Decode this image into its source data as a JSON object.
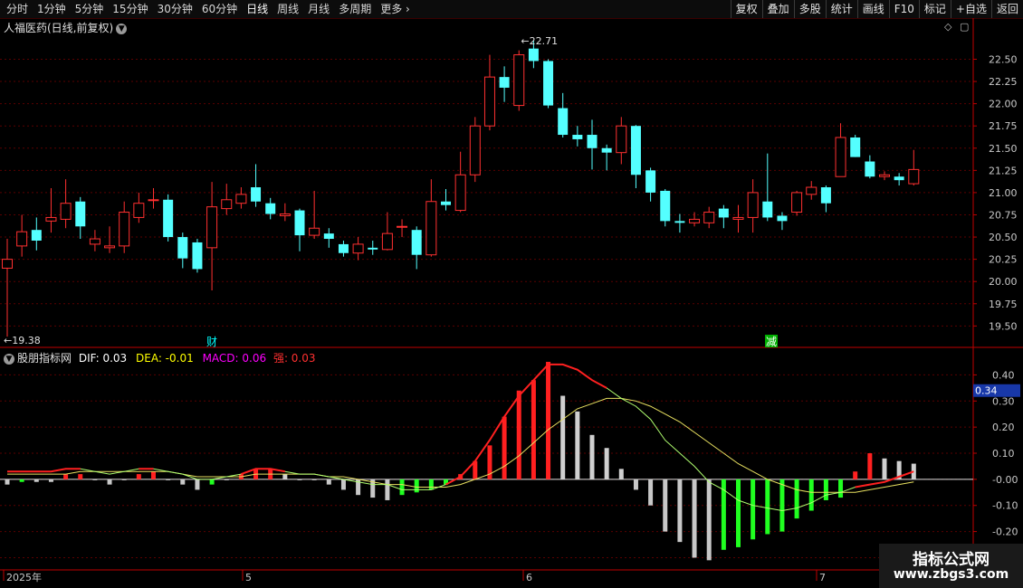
{
  "toolbar": {
    "periods": [
      "分时",
      "1分钟",
      "5分钟",
      "15分钟",
      "30分钟",
      "60分钟",
      "日线",
      "周线",
      "月线",
      "多周期",
      "更多"
    ],
    "active_period": "日线",
    "more_chevron": "chevron-right-icon",
    "right_buttons": [
      "复权",
      "叠加",
      "多股",
      "统计",
      "画线",
      "F10",
      "标记",
      "+自选",
      "返回"
    ]
  },
  "main_chart": {
    "title": "人福医药(日线,前复权)",
    "y_ticks": [
      "22.50",
      "22.25",
      "22.00",
      "21.75",
      "21.50",
      "21.25",
      "21.00",
      "20.75",
      "20.50",
      "20.25",
      "20.00",
      "19.75",
      "19.50"
    ],
    "high_marker": "22.71",
    "low_marker": "19.38",
    "event_labels": [
      "财",
      "减"
    ]
  },
  "indicator": {
    "name": "股朋指标网",
    "dif_label": "DIF: 0.03",
    "dea_label": "DEA: -0.01",
    "macd_label": "MACD: 0.06",
    "strong_label": "强: 0.03",
    "y_ticks": [
      "0.40",
      "0.30",
      "0.20",
      "0.10",
      "-0.00",
      "-0.10",
      "-0.20",
      "-0.30"
    ],
    "current_value": "0.34"
  },
  "x_axis": {
    "labels": [
      "2025年",
      "5",
      "6",
      "7"
    ]
  },
  "watermark": {
    "line1": "指标公式网",
    "line2": "www.zbgs3.com"
  },
  "colors": {
    "up": "#ff3030",
    "down": "#54ffff",
    "grid": "#5a0000",
    "axis": "#c00000",
    "dif": "#ffffff",
    "dea": "#ffff00",
    "macd": "#ff00ff",
    "strong": "#ff3030",
    "dif_line": "#b0ff70",
    "dea_line": "#e8e060"
  },
  "chart_data": {
    "type": "candlestick",
    "candles": [
      [
        20.15,
        20.25,
        20.48,
        19.38
      ],
      [
        20.4,
        20.56,
        20.75,
        20.28
      ],
      [
        20.58,
        20.46,
        20.72,
        20.35
      ],
      [
        20.68,
        20.72,
        21.05,
        20.55
      ],
      [
        20.7,
        20.88,
        21.15,
        20.6
      ],
      [
        20.9,
        20.62,
        20.95,
        20.48
      ],
      [
        20.42,
        20.48,
        20.58,
        20.34
      ],
      [
        20.38,
        20.4,
        20.62,
        20.32
      ],
      [
        20.4,
        20.78,
        20.9,
        20.32
      ],
      [
        20.72,
        20.88,
        21.0,
        20.66
      ],
      [
        20.92,
        20.92,
        21.05,
        20.82
      ],
      [
        20.92,
        20.5,
        20.98,
        20.45
      ],
      [
        20.5,
        20.26,
        20.55,
        20.15
      ],
      [
        20.44,
        20.14,
        20.48,
        20.1
      ],
      [
        20.38,
        20.84,
        21.12,
        19.9
      ],
      [
        20.82,
        20.92,
        21.1,
        20.75
      ],
      [
        20.88,
        20.98,
        21.06,
        20.82
      ],
      [
        21.06,
        20.9,
        21.32,
        20.84
      ],
      [
        20.88,
        20.76,
        20.94,
        20.7
      ],
      [
        20.74,
        20.76,
        20.88,
        20.68
      ],
      [
        20.8,
        20.52,
        20.82,
        20.34
      ],
      [
        20.52,
        20.6,
        21.02,
        20.48
      ],
      [
        20.54,
        20.48,
        20.6,
        20.38
      ],
      [
        20.42,
        20.32,
        20.46,
        20.28
      ],
      [
        20.32,
        20.42,
        20.5,
        20.24
      ],
      [
        20.38,
        20.36,
        20.46,
        20.3
      ],
      [
        20.36,
        20.54,
        20.78,
        20.35
      ],
      [
        20.62,
        20.62,
        20.7,
        20.5
      ],
      [
        20.58,
        20.3,
        20.62,
        20.14
      ],
      [
        20.3,
        20.9,
        21.15,
        20.28
      ],
      [
        20.9,
        20.86,
        21.04,
        20.8
      ],
      [
        20.8,
        21.2,
        21.46,
        20.78
      ],
      [
        21.2,
        21.75,
        21.85,
        21.12
      ],
      [
        21.75,
        22.3,
        22.55,
        21.7
      ],
      [
        22.3,
        22.18,
        22.42,
        22.02
      ],
      [
        21.98,
        22.55,
        22.6,
        21.92
      ],
      [
        22.62,
        22.48,
        22.71,
        22.4
      ],
      [
        22.48,
        21.98,
        22.5,
        21.95
      ],
      [
        21.95,
        21.65,
        22.12,
        21.62
      ],
      [
        21.65,
        21.6,
        21.75,
        21.52
      ],
      [
        21.65,
        21.5,
        21.82,
        21.26
      ],
      [
        21.5,
        21.45,
        21.54,
        21.25
      ],
      [
        21.45,
        21.75,
        21.85,
        21.32
      ],
      [
        21.75,
        21.2,
        21.76,
        21.05
      ],
      [
        21.25,
        21.0,
        21.28,
        20.9
      ],
      [
        21.02,
        20.68,
        21.04,
        20.62
      ],
      [
        20.68,
        20.66,
        20.76,
        20.55
      ],
      [
        20.66,
        20.7,
        20.78,
        20.62
      ],
      [
        20.66,
        20.78,
        20.84,
        20.6
      ],
      [
        20.82,
        20.72,
        20.86,
        20.6
      ],
      [
        20.7,
        20.72,
        20.86,
        20.55
      ],
      [
        20.72,
        21.0,
        21.15,
        20.55
      ],
      [
        20.9,
        20.72,
        21.44,
        20.68
      ],
      [
        20.74,
        20.68,
        20.78,
        20.58
      ],
      [
        20.78,
        21.0,
        21.02,
        20.74
      ],
      [
        20.98,
        21.06,
        21.13,
        20.92
      ],
      [
        21.06,
        20.88,
        21.08,
        20.78
      ],
      [
        21.18,
        21.62,
        21.78,
        21.18
      ],
      [
        21.62,
        21.4,
        21.65,
        21.4
      ],
      [
        21.35,
        21.18,
        21.42,
        21.16
      ],
      [
        21.18,
        21.2,
        21.24,
        21.14
      ],
      [
        21.18,
        21.14,
        21.22,
        21.08
      ],
      [
        21.1,
        21.26,
        21.48,
        21.08
      ]
    ],
    "dif": [
      0.03,
      0.03,
      0.03,
      0.03,
      0.04,
      0.04,
      0.03,
      0.02,
      0.03,
      0.04,
      0.04,
      0.03,
      0.02,
      0.0,
      0.0,
      0.01,
      0.02,
      0.04,
      0.04,
      0.03,
      0.02,
      0.02,
      0.01,
      0.0,
      -0.01,
      -0.02,
      -0.02,
      -0.04,
      -0.04,
      -0.04,
      -0.02,
      0.01,
      0.07,
      0.15,
      0.24,
      0.32,
      0.38,
      0.44,
      0.44,
      0.42,
      0.38,
      0.35,
      0.31,
      0.28,
      0.23,
      0.15,
      0.1,
      0.05,
      -0.01,
      -0.04,
      -0.08,
      -0.1,
      -0.11,
      -0.12,
      -0.11,
      -0.09,
      -0.06,
      -0.05,
      -0.03,
      -0.02,
      -0.01,
      0.01,
      0.03
    ],
    "dea": [
      0.02,
      0.02,
      0.02,
      0.02,
      0.02,
      0.03,
      0.03,
      0.03,
      0.03,
      0.03,
      0.03,
      0.03,
      0.02,
      0.01,
      0.01,
      0.01,
      0.01,
      0.02,
      0.02,
      0.02,
      0.02,
      0.02,
      0.01,
      0.01,
      0.0,
      -0.01,
      -0.02,
      -0.02,
      -0.03,
      -0.03,
      -0.03,
      -0.02,
      0.0,
      0.02,
      0.05,
      0.09,
      0.14,
      0.19,
      0.23,
      0.27,
      0.29,
      0.31,
      0.31,
      0.3,
      0.28,
      0.25,
      0.22,
      0.18,
      0.14,
      0.1,
      0.06,
      0.03,
      0.0,
      -0.02,
      -0.04,
      -0.05,
      -0.05,
      -0.05,
      -0.05,
      -0.04,
      -0.03,
      -0.02,
      -0.01
    ],
    "macd": [
      -0.02,
      -0.01,
      -0.01,
      -0.01,
      0.02,
      0.02,
      0.0,
      -0.02,
      0.0,
      0.02,
      0.03,
      0.0,
      -0.02,
      -0.04,
      -0.02,
      0.0,
      0.02,
      0.04,
      0.04,
      0.02,
      0.0,
      0.0,
      -0.02,
      -0.04,
      -0.06,
      -0.07,
      -0.08,
      -0.06,
      -0.05,
      -0.04,
      -0.02,
      0.02,
      0.07,
      0.13,
      0.24,
      0.34,
      0.38,
      0.45,
      0.32,
      0.26,
      0.17,
      0.12,
      0.04,
      -0.04,
      -0.1,
      -0.2,
      -0.24,
      -0.3,
      -0.31,
      -0.27,
      -0.26,
      -0.23,
      -0.21,
      -0.2,
      -0.15,
      -0.12,
      -0.08,
      -0.07,
      0.03,
      0.1,
      0.08,
      0.07,
      0.06
    ],
    "y_range": [
      19.3,
      22.8
    ],
    "indicator_range": [
      -0.34,
      0.45
    ],
    "grid": true
  }
}
